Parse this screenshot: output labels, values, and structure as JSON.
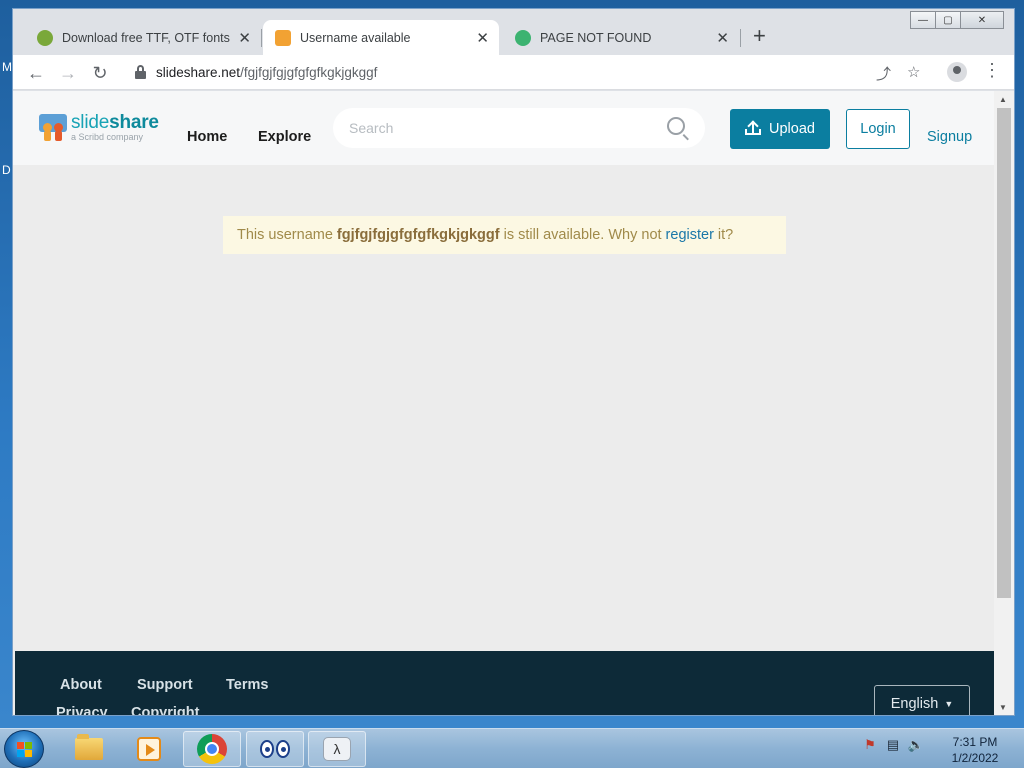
{
  "desktop": {
    "letters": [
      "M",
      "D"
    ]
  },
  "browser": {
    "tabs": [
      {
        "title": "Download free TTF, OTF fonts | C",
        "close": "✕",
        "active": false,
        "favicon_color": "#7aa83a"
      },
      {
        "title": "Username available",
        "close": "✕",
        "active": true,
        "favicon_color": "#f2a233"
      },
      {
        "title": "PAGE NOT FOUND",
        "close": "✕",
        "active": false,
        "favicon_color": "#3cb371"
      }
    ],
    "new_tab": "+",
    "window_controls": {
      "minimize": "—",
      "maximize": "▢",
      "close": "✕"
    },
    "url_host": "slideshare.net",
    "url_path": "/fgjfgjfgjgfgfgfkgkjgkggf",
    "icons": [
      "back-arrow-icon",
      "forward-arrow-icon",
      "reload-icon",
      "lock-icon",
      "share-icon",
      "star-icon",
      "profile-icon",
      "menu-icon"
    ]
  },
  "site": {
    "logo_main_light": "slide",
    "logo_main_bold": "share",
    "logo_sub": "a Scribd company",
    "nav": {
      "home": "Home",
      "explore": "Explore"
    },
    "search_placeholder": "Search",
    "upload": "Upload",
    "login": "Login",
    "signup": "Signup",
    "accent_color": "#0b7ea0"
  },
  "notice": {
    "prefix": "This username",
    "username": "fgjfgjfgjgfgfgfkgkjgkggf",
    "middle": "is still available. Why not",
    "link": "register",
    "suffix": "it?"
  },
  "footer": {
    "links": [
      "About",
      "Support",
      "Terms",
      "Privacy",
      "Copyright"
    ],
    "language": "English"
  },
  "taskbar": {
    "clock_time": "7:31 PM",
    "clock_date": "1/2/2022"
  }
}
